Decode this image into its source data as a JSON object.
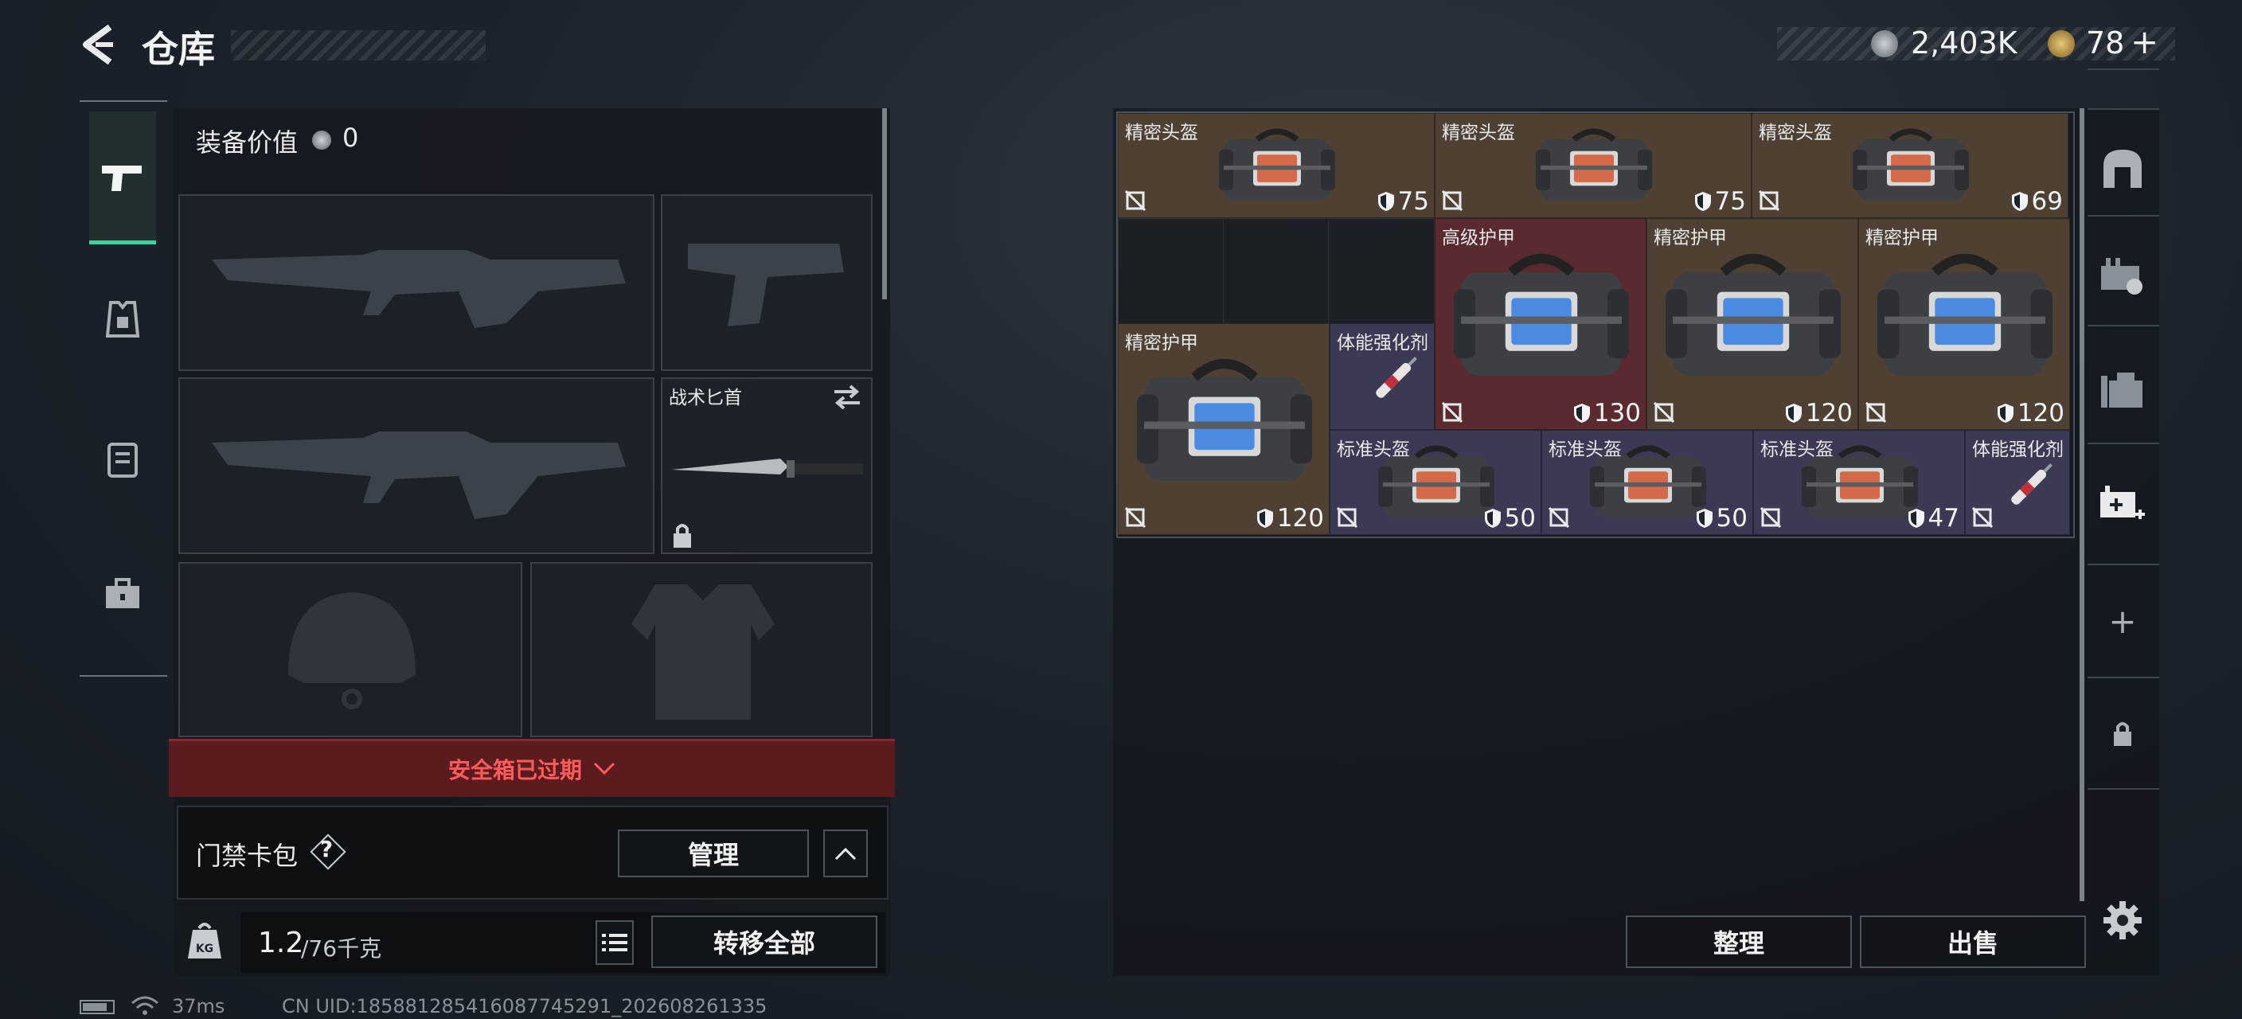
{
  "header": {
    "title": "仓库",
    "currency_main": "2,403K",
    "currency_secondary": "78",
    "currency_plus": "+"
  },
  "loadout": {
    "value_label": "装备价值",
    "value": "0",
    "knife_label": "战术匕首",
    "safebox_expired": "安全箱已过期",
    "keycard_label": "门禁卡包",
    "keycard_help": "?",
    "manage_button": "管理",
    "weight_current": "1.2",
    "weight_max": "/76千克",
    "transfer_all_button": "转移全部"
  },
  "stash": {
    "items": [
      {
        "name": "精密头盔",
        "durability": "75",
        "color": "brown"
      },
      {
        "name": "精密头盔",
        "durability": "75",
        "color": "brown"
      },
      {
        "name": "精密头盔",
        "durability": "69",
        "color": "brown"
      },
      {
        "name": "高级护甲",
        "durability": "130",
        "color": "red"
      },
      {
        "name": "精密护甲",
        "durability": "120",
        "color": "brown"
      },
      {
        "name": "精密护甲",
        "durability": "120",
        "color": "brown"
      },
      {
        "name": "精密护甲",
        "durability": "120",
        "color": "brown"
      },
      {
        "name": "体能强化剂",
        "durability": "",
        "color": "purple"
      },
      {
        "name": "标准头盔",
        "durability": "50",
        "color": "purple"
      },
      {
        "name": "标准头盔",
        "durability": "50",
        "color": "purple"
      },
      {
        "name": "标准头盔",
        "durability": "47",
        "color": "purple"
      },
      {
        "name": "体能强化剂",
        "durability": "",
        "color": "purple"
      }
    ],
    "sort_button": "整理",
    "sell_button": "出售"
  },
  "right_rail": {
    "add_icon": "+"
  },
  "status_bar": {
    "ping": "37ms",
    "uid": "CN UID:185881285416087745291_202608261335"
  },
  "colors": {
    "brown": "#4e4133",
    "red": "#5a2a2e",
    "purple": "#3a3a55",
    "alert_red": "#6b1e22",
    "accent_green": "#3fd1a0"
  }
}
